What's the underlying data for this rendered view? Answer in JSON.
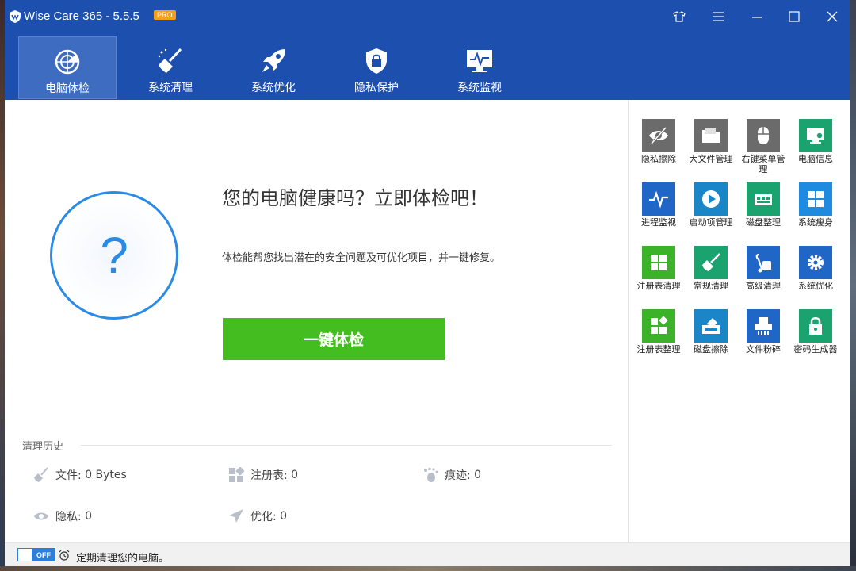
{
  "app": {
    "title": "Wise Care 365 - 5.5.5",
    "badge": "PRO"
  },
  "nav": {
    "tabs": [
      {
        "label": "电脑体检",
        "icon": "radar-icon"
      },
      {
        "label": "系统清理",
        "icon": "broom-icon"
      },
      {
        "label": "系统优化",
        "icon": "rocket-icon"
      },
      {
        "label": "隐私保护",
        "icon": "shield-lock-icon"
      },
      {
        "label": "系统监视",
        "icon": "monitor-pulse-icon"
      }
    ]
  },
  "main": {
    "headline": "您的电脑健康吗？立即体检吧！",
    "description": "体检能帮您找出潜在的安全问题及可优化项目，并一键修复。",
    "ring_symbol": "?",
    "scan_button": "一键体检",
    "history": {
      "title": "清理历史",
      "files_label": "文件:",
      "files_value": "0 Bytes",
      "registry_label": "注册表:",
      "registry_value": "0",
      "traces_label": "痕迹:",
      "traces_value": "0",
      "privacy_label": "隐私:",
      "privacy_value": "0",
      "optimize_label": "优化:",
      "optimize_value": "0"
    }
  },
  "status": {
    "toggle": "OFF",
    "text": "定期清理您的电脑。"
  },
  "tools": [
    {
      "label": "隐私擦除",
      "color": "#6b6b6b",
      "icon": "eye-slash-icon"
    },
    {
      "label": "大文件管理",
      "color": "#6b6b6b",
      "icon": "folder-icon"
    },
    {
      "label": "右键菜单管理",
      "color": "#6b6b6b",
      "icon": "mouse-icon"
    },
    {
      "label": "电脑信息",
      "color": "#1aa36e",
      "icon": "computer-gear-icon"
    },
    {
      "label": "进程监视",
      "color": "#1f66c6",
      "icon": "pulse-icon"
    },
    {
      "label": "启动项管理",
      "color": "#1a86c8",
      "icon": "play-icon"
    },
    {
      "label": "磁盘整理",
      "color": "#1aa36e",
      "icon": "disk-icon"
    },
    {
      "label": "系统瘦身",
      "color": "#1f8be0",
      "icon": "windows-icon"
    },
    {
      "label": "注册表清理",
      "color": "#3bb22a",
      "icon": "grid-icon"
    },
    {
      "label": "常规清理",
      "color": "#1aa36e",
      "icon": "broom-icon"
    },
    {
      "label": "高级清理",
      "color": "#1f66c6",
      "icon": "vacuum-icon"
    },
    {
      "label": "系统优化",
      "color": "#1f66c6",
      "icon": "gear-icon"
    },
    {
      "label": "注册表整理",
      "color": "#3bb22a",
      "icon": "registry-defrag-icon"
    },
    {
      "label": "磁盘擦除",
      "color": "#1a86c8",
      "icon": "disk-erase-icon"
    },
    {
      "label": "文件粉碎",
      "color": "#1f66c6",
      "icon": "shredder-icon"
    },
    {
      "label": "密码生成器",
      "color": "#1aa36e",
      "icon": "lock-icon"
    }
  ]
}
